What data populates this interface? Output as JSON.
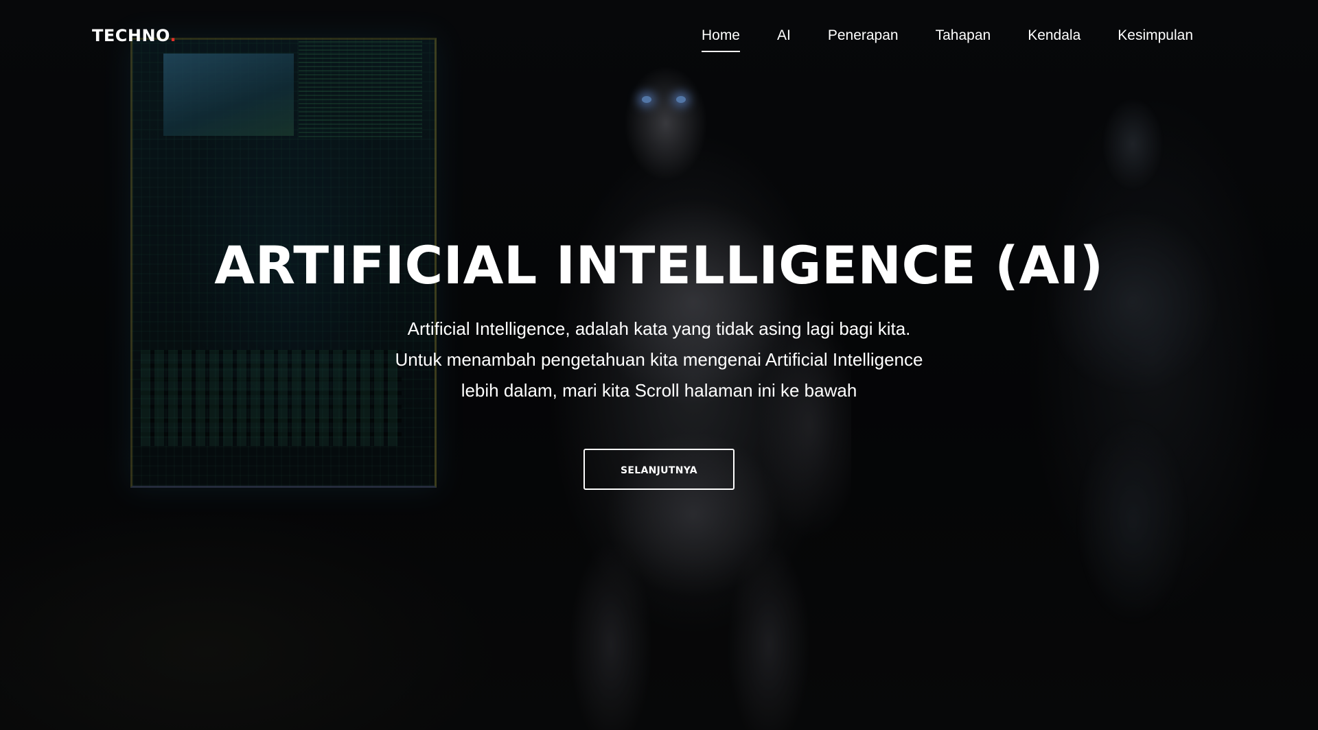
{
  "brand": {
    "name": "TECHNO",
    "dot": ".",
    "accent_color": "#e0312a"
  },
  "nav": {
    "items": [
      {
        "label": "Home",
        "active": true
      },
      {
        "label": "AI",
        "active": false
      },
      {
        "label": "Penerapan",
        "active": false
      },
      {
        "label": "Tahapan",
        "active": false
      },
      {
        "label": "Kendala",
        "active": false
      },
      {
        "label": "Kesimpulan",
        "active": false
      }
    ]
  },
  "hero": {
    "title": "ARTIFICIAL INTELLIGENCE (AI)",
    "description_lines": [
      "Artificial Intelligence, adalah kata yang tidak asing lagi bagi kita.",
      "Untuk menambah pengetahuan kita mengenai Artificial Intelligence",
      "lebih dalam, mari kita Scroll halaman ini ke bawah"
    ],
    "cta_label": "SELANJUTNYA"
  }
}
